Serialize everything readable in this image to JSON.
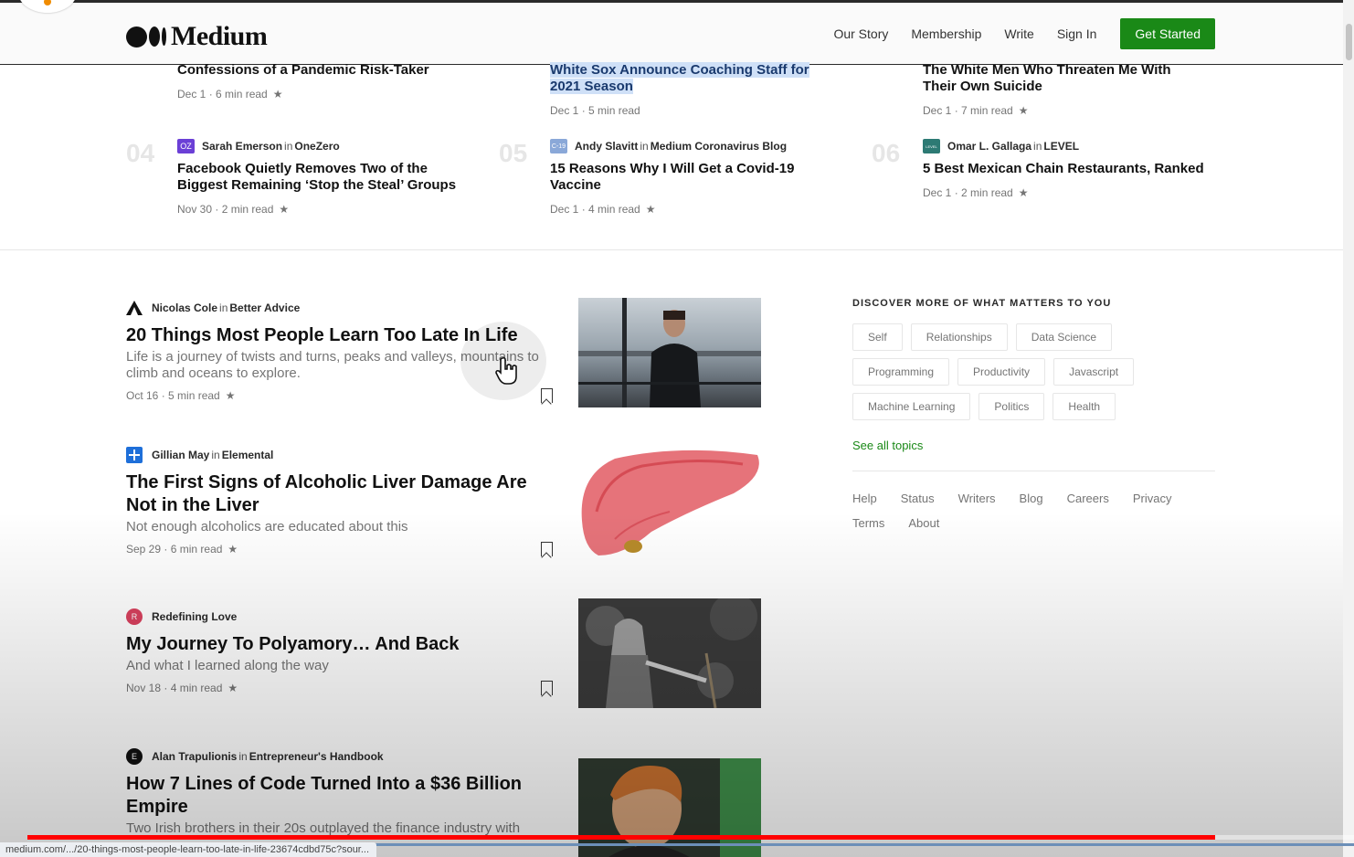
{
  "header": {
    "logo_text": "Medium",
    "nav": [
      "Our Story",
      "Membership",
      "Write",
      "Sign In"
    ],
    "cta": "Get Started",
    "cta_color": "#1a8917"
  },
  "trending": [
    {
      "title": "Confessions of a Pandemic Risk-Taker",
      "date": "Dec 1",
      "read": "6 min read"
    },
    {
      "title": "White Sox Announce Coaching Staff for 2021 Season",
      "date": "Dec 1",
      "read": "5 min read",
      "highlighted": true
    },
    {
      "title": "The White Men Who Threaten Me With Their Own Suicide",
      "date": "Dec 1",
      "read": "7 min read"
    },
    {
      "num": "04",
      "author": "Sarah Emerson",
      "pub": "OneZero",
      "icon": "OZ",
      "icon_color": "#6b3fd6",
      "title": "Facebook Quietly Removes Two of the Biggest Remaining ‘Stop the Steal’ Groups",
      "date": "Nov 30",
      "read": "2 min read"
    },
    {
      "num": "05",
      "author": "Andy Slavitt",
      "pub": "Medium Coronavirus Blog",
      "icon": "C-19",
      "icon_color": "#8aa8d8",
      "title": "15 Reasons Why I Will Get a Covid-19 Vaccine",
      "date": "Dec 1",
      "read": "4 min read"
    },
    {
      "num": "06",
      "author": "Omar L. Gallaga",
      "pub": "LEVEL",
      "icon": "LEVEL",
      "icon_color": "#2d7a74",
      "title": "5 Best Mexican Chain Restaurants, Ranked",
      "date": "Dec 1",
      "read": "2 min read"
    }
  ],
  "in_word": "in",
  "star": "★",
  "posts": [
    {
      "author": "Nicolas Cole",
      "pub": "Better Advice",
      "icon": "triangle",
      "title": "20 Things Most People Learn Too Late In Life",
      "subtitle": "Life is a journey of twists and turns, peaks and valleys, mountains to climb and oceans to explore.",
      "date": "Oct 16",
      "read": "5 min read"
    },
    {
      "author": "Gillian May",
      "pub": "Elemental",
      "icon": "plus",
      "title": "The First Signs of Alcoholic Liver Damage Are Not in the Liver",
      "subtitle": "Not enough alcoholics are educated about this",
      "date": "Sep 29",
      "read": "6 min read"
    },
    {
      "author": "",
      "pub": "Redefining Love",
      "icon": "R",
      "title": "My Journey To Polyamory… And Back",
      "subtitle": "And what I learned along the way",
      "date": "Nov 18",
      "read": "4 min read"
    },
    {
      "author": "Alan Trapulionis",
      "pub": "Entrepreneur's Handbook",
      "icon": "E",
      "title": "How 7 Lines of Code Turned Into a $36 Billion Empire",
      "subtitle": "Two Irish brothers in their 20s outplayed the finance industry with",
      "date": "",
      "read": ""
    }
  ],
  "sidebar": {
    "heading": "DISCOVER MORE OF WHAT MATTERS TO YOU",
    "tags": [
      "Self",
      "Relationships",
      "Data Science",
      "Programming",
      "Productivity",
      "Javascript",
      "Machine Learning",
      "Politics",
      "Health"
    ],
    "see_all": "See all topics",
    "footer": [
      "Help",
      "Status",
      "Writers",
      "Blog",
      "Careers",
      "Privacy",
      "Terms",
      "About"
    ]
  },
  "player": {
    "progress": 0.895,
    "progress_color": "#ff0000"
  },
  "status_url": "medium.com/.../20-things-most-people-learn-too-late-in-life-23674cdbd75c?sour..."
}
